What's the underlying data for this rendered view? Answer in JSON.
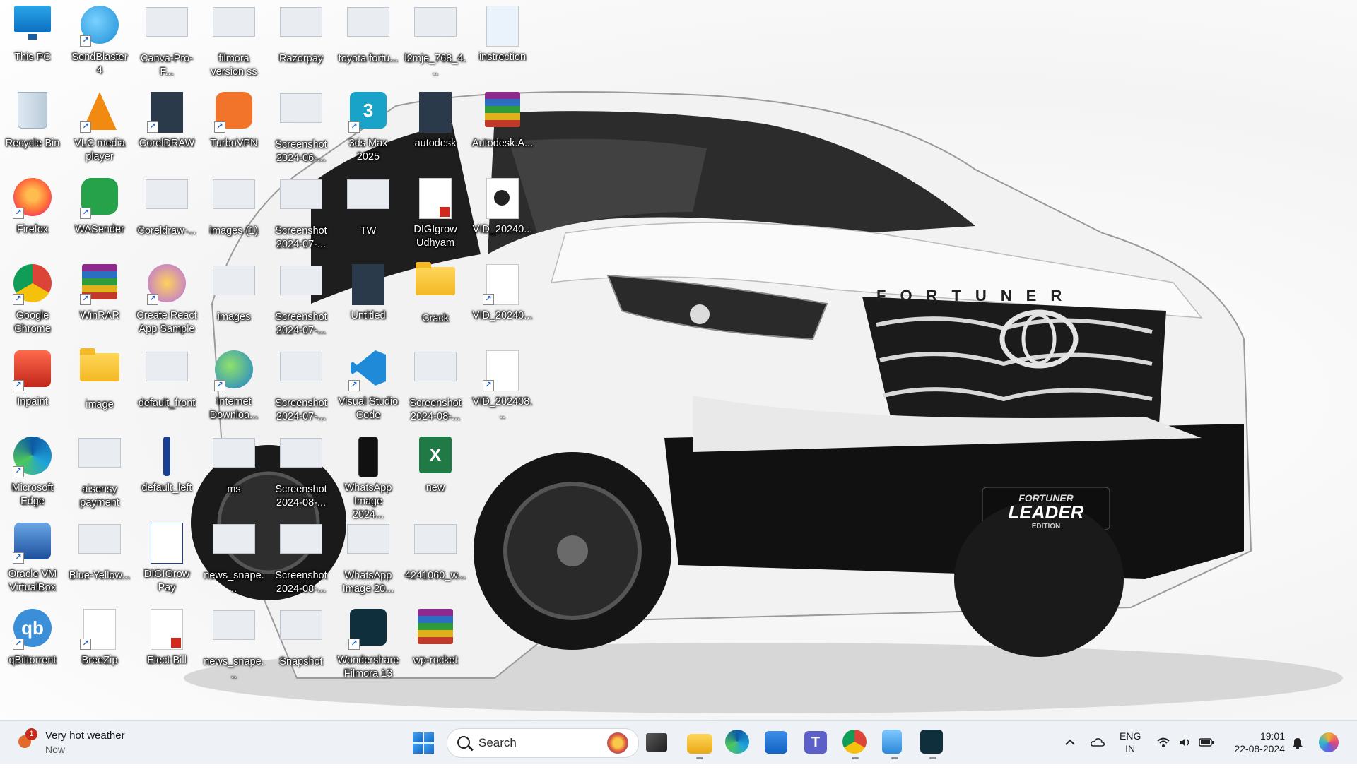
{
  "desktop": {
    "icons": [
      {
        "label": "This PC",
        "glyph": "monitor-icon"
      },
      {
        "label": "SendBlaster 4",
        "glyph": "bird-icon"
      },
      {
        "label": "Canva-Pro-F...",
        "glyph": "thumbnail-icon"
      },
      {
        "label": "filmora version ss",
        "glyph": "thumbnail-icon"
      },
      {
        "label": "Razorpay",
        "glyph": "thumbnail-icon"
      },
      {
        "label": "toyota fortu...",
        "glyph": "thumbnail-icon"
      },
      {
        "label": "l2mje_768_4...",
        "glyph": "thumbnail-icon"
      },
      {
        "label": "instrection",
        "glyph": "notepad-icon"
      },
      {
        "label": "Recycle Bin",
        "glyph": "recycle-bin-icon"
      },
      {
        "label": "VLC media player",
        "glyph": "vlc-icon"
      },
      {
        "label": "CorelDRAW",
        "glyph": "coreldraw-icon"
      },
      {
        "label": "TurboVPN",
        "glyph": "turbovpn-icon"
      },
      {
        "label": "Screenshot 2024-06-...",
        "glyph": "thumbnail-icon"
      },
      {
        "label": "3ds Max 2025",
        "glyph": "3ds-max-icon",
        "badge": "3",
        "sub": "MAX"
      },
      {
        "label": "autodesk",
        "glyph": "document-icon"
      },
      {
        "label": "Autodesk.A...",
        "glyph": "winrar-archive-icon"
      },
      {
        "label": "Firefox",
        "glyph": "firefox-icon"
      },
      {
        "label": "WASender",
        "glyph": "wasender-icon"
      },
      {
        "label": "Coreldraw-...",
        "glyph": "thumbnail-icon"
      },
      {
        "label": "images (1)",
        "glyph": "thumbnail-icon"
      },
      {
        "label": "Screenshot 2024-07-...",
        "glyph": "thumbnail-icon"
      },
      {
        "label": "TW",
        "glyph": "thumbnail-icon"
      },
      {
        "label": "DIGIgrow Udhyam",
        "glyph": "pdf-icon"
      },
      {
        "label": "VID_20240...",
        "glyph": "video-icon"
      },
      {
        "label": "Google Chrome",
        "glyph": "chrome-icon"
      },
      {
        "label": "WinRAR",
        "glyph": "winrar-icon"
      },
      {
        "label": "Create React App Sample",
        "glyph": "react-icon"
      },
      {
        "label": "images",
        "glyph": "thumbnail-icon"
      },
      {
        "label": "Screenshot 2024-07-...",
        "glyph": "thumbnail-icon"
      },
      {
        "label": "Untitled",
        "glyph": "document-icon"
      },
      {
        "label": "Crack",
        "glyph": "folder-icon"
      },
      {
        "label": "VID_20240...",
        "glyph": "blank-file-icon"
      },
      {
        "label": "Inpaint",
        "glyph": "inpaint-icon"
      },
      {
        "label": "image",
        "glyph": "folder-icon"
      },
      {
        "label": "default_front",
        "glyph": "thumbnail-icon"
      },
      {
        "label": "Internet Downloa...",
        "glyph": "idm-icon"
      },
      {
        "label": "Screenshot 2024-07-...",
        "glyph": "thumbnail-icon"
      },
      {
        "label": "Visual Studio Code",
        "glyph": "vscode-icon"
      },
      {
        "label": "Screenshot 2024-08-...",
        "glyph": "thumbnail-icon"
      },
      {
        "label": "VID_202408...",
        "glyph": "blank-file-icon"
      },
      {
        "label": "Microsoft Edge",
        "glyph": "edge-icon"
      },
      {
        "label": "aisensy payment",
        "glyph": "thumbnail-icon"
      },
      {
        "label": "default_left",
        "glyph": "pen-icon"
      },
      {
        "label": "ms",
        "glyph": "thumbnail-icon"
      },
      {
        "label": "Screenshot 2024-08-...",
        "glyph": "thumbnail-icon"
      },
      {
        "label": "WhatsApp Image 2024...",
        "glyph": "phone-image-icon"
      },
      {
        "label": "new",
        "glyph": "excel-icon",
        "badge": "X"
      },
      {
        "label": "Oracle VM VirtualBox",
        "glyph": "virtualbox-icon"
      },
      {
        "label": "Blue-Yellow...",
        "glyph": "thumbnail-icon"
      },
      {
        "label": "DIGIGrow Pay",
        "glyph": "qr-doc-icon"
      },
      {
        "label": "news_snape...",
        "glyph": "thumbnail-icon"
      },
      {
        "label": "Screenshot 2024-08-...",
        "glyph": "thumbnail-icon"
      },
      {
        "label": "WhatsApp Image 20...",
        "glyph": "thumbnail-icon"
      },
      {
        "label": "4241060_w...",
        "glyph": "thumbnail-icon"
      },
      {
        "label": "qBittorrent",
        "glyph": "qbittorrent-icon",
        "badge": "qb"
      },
      {
        "label": "BreeZip",
        "glyph": "blank-file-icon"
      },
      {
        "label": "Elect Bill",
        "glyph": "pdf-icon"
      },
      {
        "label": "news_snape...",
        "glyph": "thumbnail-icon"
      },
      {
        "label": "Snapshot",
        "glyph": "thumbnail-icon"
      },
      {
        "label": "Wondershare Filmora 13",
        "glyph": "filmora-icon"
      },
      {
        "label": "wp-rocket",
        "glyph": "winrar-archive-icon"
      }
    ]
  },
  "wallpaper": {
    "badge_text": "FORTUNER",
    "plate_line1": "FORTUNER",
    "plate_line2": "LEADER",
    "plate_line3": "EDITION"
  },
  "taskbar": {
    "weather": {
      "title": "Very hot weather",
      "subtitle": "Now",
      "badge": "1"
    },
    "search": {
      "placeholder": "Search"
    },
    "apps": [
      "task-view-icon",
      "file-explorer-icon",
      "edge-icon",
      "microsoft-store-icon",
      "teams-icon",
      "chrome-icon",
      "notepad-icon",
      "filmora-icon"
    ],
    "tray": {
      "lang_line1": "ENG",
      "lang_line2": "IN",
      "time": "19:01",
      "date": "22-08-2024"
    }
  },
  "colors": {
    "taskbar_bg": "#eef1f6",
    "accent": "#0067c0"
  }
}
